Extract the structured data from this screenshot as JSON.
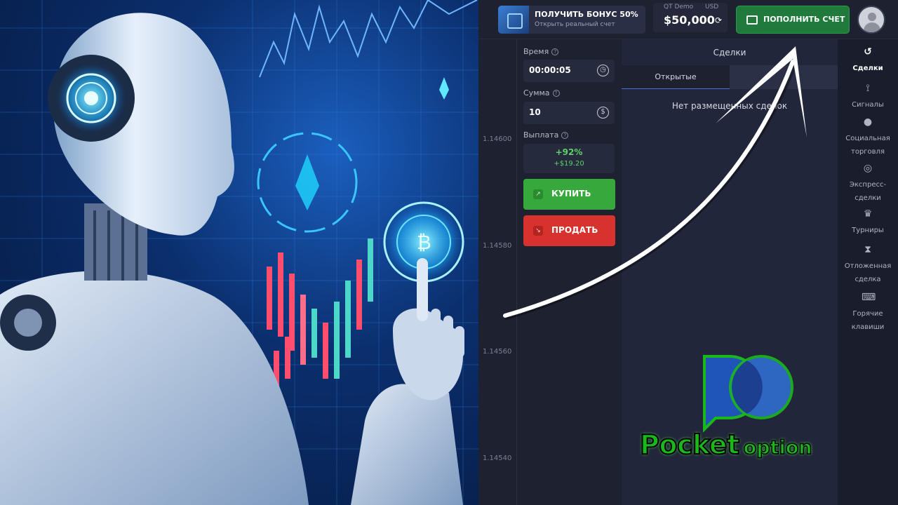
{
  "topbar": {
    "bonus_title": "ПОЛУЧИТЬ БОНУС 50%",
    "bonus_subtitle": "Открыть реальный счет",
    "account_type": "QT Demo",
    "currency": "USD",
    "balance": "$50,000",
    "deposit_label": "ПОПОЛНИТЬ СЧЕТ"
  },
  "prices": [
    "1.14600",
    "1.14580",
    "1.14560",
    "1.14540"
  ],
  "panel": {
    "time_label": "Время",
    "time_value": "00:00:05",
    "amount_label": "Сумма",
    "amount_value": "10",
    "payout_label": "Выплата",
    "payout_percent": "+92%",
    "payout_amount": "+$19.20",
    "buy_label": "КУПИТЬ",
    "sell_label": "ПРОДАТЬ"
  },
  "deals": {
    "title": "Сделки",
    "tab_open": "Открытые",
    "tab_closed": "",
    "empty_message": "Нет размещенных сделок"
  },
  "sidebar": {
    "items": [
      {
        "label": "Сделки",
        "icon": "history-icon"
      },
      {
        "label": "Сигналы",
        "icon": "signal-icon"
      },
      {
        "label": "Социальная торговля",
        "icon": "people-icon"
      },
      {
        "label": "Экспресс-сделки",
        "icon": "target-icon"
      },
      {
        "label": "Турниры",
        "icon": "trophy-icon"
      },
      {
        "label": "Отложенная сделка",
        "icon": "hourglass-icon"
      },
      {
        "label": "Горячие клавиши",
        "icon": "keyboard-icon"
      }
    ]
  },
  "logo": {
    "word1": "Pocket",
    "word2": "option",
    "colors": {
      "green": "#1bb81b",
      "blue": "#2f6fd0"
    }
  },
  "colors": {
    "buy": "#37a83c",
    "sell": "#d8322f",
    "deposit": "#1f7a3c",
    "background": "#1e2130"
  }
}
